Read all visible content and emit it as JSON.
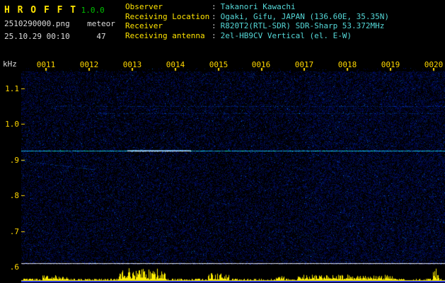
{
  "app": {
    "title": "H R O F F T",
    "version": "1.0.0",
    "filename": "2510290000.png",
    "mode": "meteor",
    "datetime": "25.10.29 00:10",
    "count": "47"
  },
  "info": {
    "separator": ":",
    "rows": [
      {
        "label": "Observer",
        "value": "Takanori Kawachi"
      },
      {
        "label": "Receiving Location",
        "value": "Ogaki, Gifu, JAPAN (136.60E, 35.35N)"
      },
      {
        "label": "Receiver",
        "value": "R820T2(RTL-SDR) SDR-Sharp 53.372MHz"
      },
      {
        "label": "Receiving antenna",
        "value": "2el-HB9CV Vertical (el. E-W)"
      }
    ]
  },
  "chart_data": {
    "type": "heatmap",
    "x_ticks": [
      "0011",
      "0012",
      "0013",
      "0014",
      "0015",
      "0016",
      "0017",
      "0018",
      "0019",
      "0020"
    ],
    "y_unit": "kHz",
    "y_ticks": [
      "1.1",
      "1.0",
      ".9",
      ".8",
      ".7",
      ".6"
    ],
    "y_range_khz": [
      0.6,
      1.15
    ],
    "carrier_line_khz": 0.925,
    "carrier_bright_segment_frac": [
      0.25,
      0.4
    ],
    "faint_traces_khz": [
      1.05,
      1.03
    ],
    "baseline_line_khz": 0.61,
    "colors": {
      "noise": "#0020a0",
      "carrier": "#7dffff",
      "baseline": "#ffffff",
      "meter_bars": "#ffee00",
      "meter_floor": "#2233ee",
      "axis_labels": "#ffd700"
    },
    "meter_bursts": [
      {
        "start_frac": 0.05,
        "end_frac": 0.11,
        "max_h": 6
      },
      {
        "start_frac": 0.23,
        "end_frac": 0.34,
        "max_h": 16
      },
      {
        "start_frac": 0.44,
        "end_frac": 0.49,
        "max_h": 9
      },
      {
        "start_frac": 0.6,
        "end_frac": 0.62,
        "max_h": 5
      },
      {
        "start_frac": 0.65,
        "end_frac": 0.88,
        "max_h": 7
      },
      {
        "start_frac": 0.97,
        "end_frac": 0.985,
        "max_h": 20
      }
    ]
  }
}
